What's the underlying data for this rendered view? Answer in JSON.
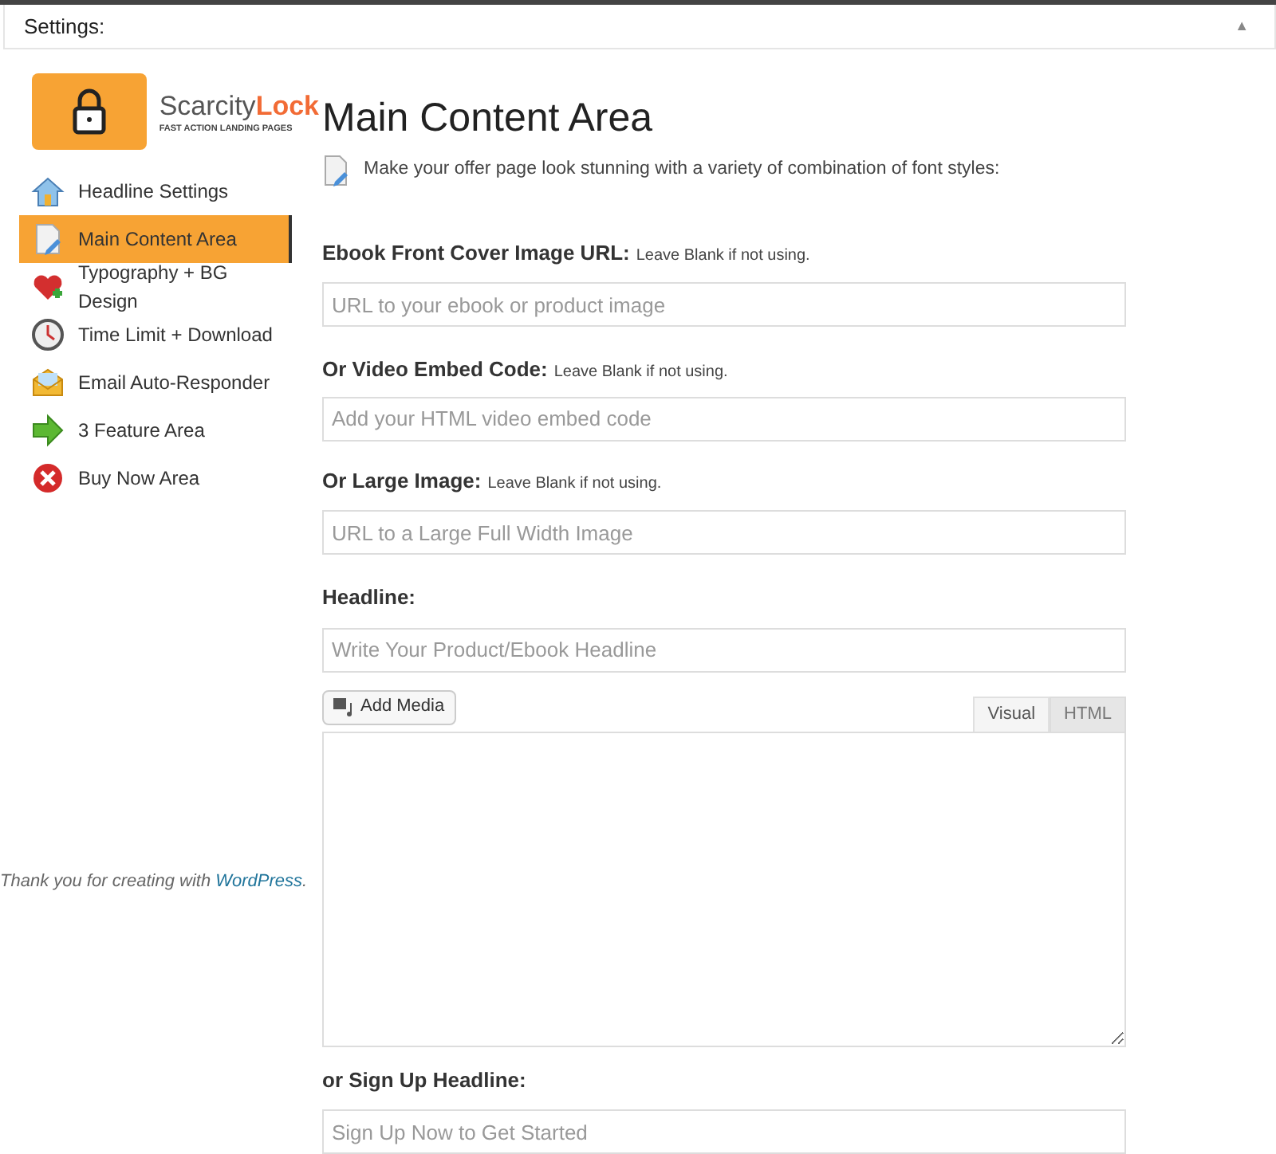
{
  "panel": {
    "title": "Settings:",
    "toggle": "▲"
  },
  "logo": {
    "name_part1": "Scarcity",
    "name_part2": "Lock",
    "tagline": "FAST ACTION LANDING PAGES"
  },
  "sidebar": {
    "items": [
      {
        "label": "Headline Settings",
        "selected": false
      },
      {
        "label": "Main Content Area",
        "selected": true
      },
      {
        "label": "Typography + BG Design",
        "selected": false
      },
      {
        "label": "Time Limit + Download",
        "selected": false
      },
      {
        "label": "Email Auto-Responder",
        "selected": false
      },
      {
        "label": "3 Feature Area",
        "selected": false
      },
      {
        "label": "Buy Now Area",
        "selected": false
      }
    ]
  },
  "footer": {
    "text": "Thank you for creating with ",
    "link": "WordPress",
    "end": "."
  },
  "content": {
    "title": "Main Content Area",
    "intro": "Make your offer page look stunning with a variety of combination of font styles:",
    "fields": [
      {
        "label": "Ebook Front Cover Image URL:",
        "note": "Leave Blank if not using.",
        "placeholder": "URL to your ebook or product image"
      },
      {
        "label": "Or Video Embed Code:",
        "note": "Leave Blank if not using.",
        "placeholder": "Add your HTML video embed code"
      },
      {
        "label": "Or Large Image:",
        "note": "Leave Blank if not using.",
        "placeholder": "URL to a Large Full Width Image"
      },
      {
        "label": "Headline:",
        "placeholder": "Write Your Product/Ebook Headline"
      }
    ],
    "editor": {
      "add_media": "Add Media",
      "tabs": [
        {
          "label": "Visual",
          "selected": true
        },
        {
          "label": "HTML",
          "selected": false
        }
      ]
    },
    "signup": {
      "label": "or Sign Up Headline:",
      "placeholder": "Sign Up Now to Get Started"
    }
  }
}
